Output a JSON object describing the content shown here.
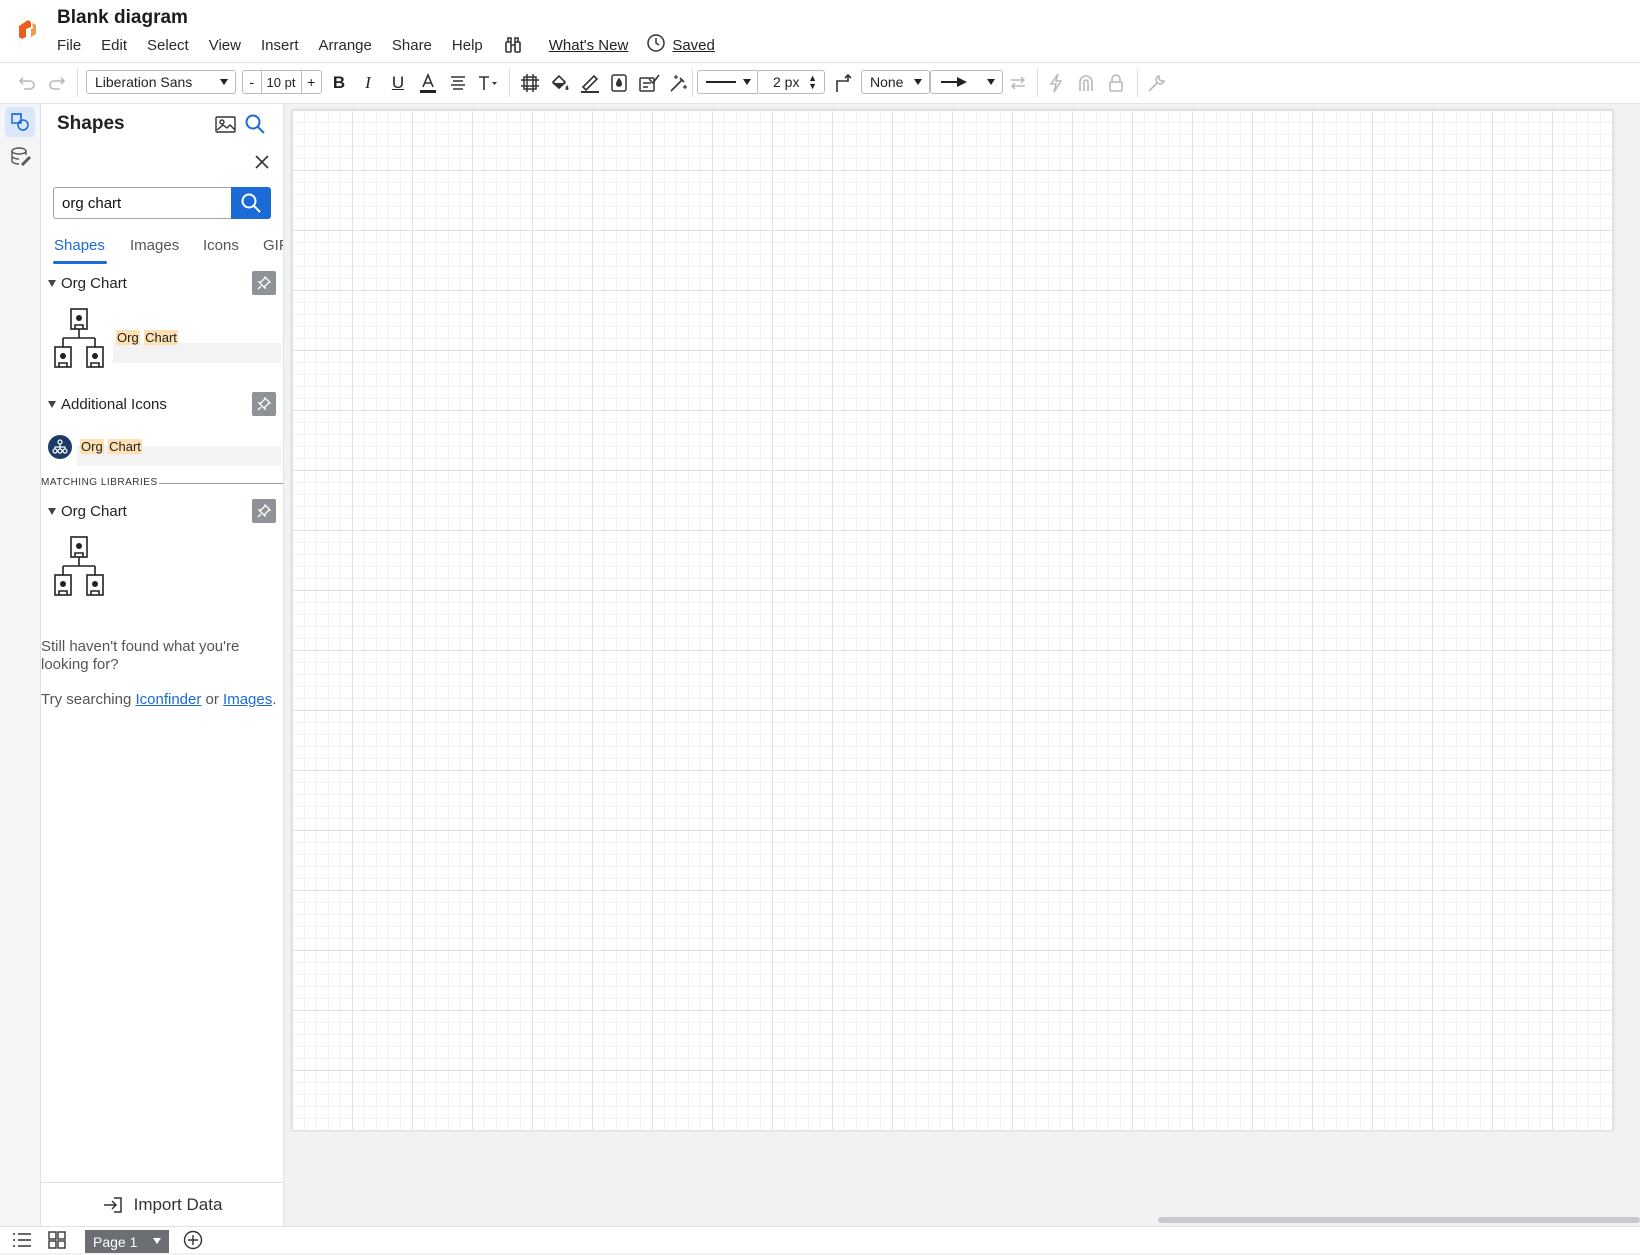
{
  "app": {
    "title": "Blank diagram",
    "menus": [
      "File",
      "Edit",
      "Select",
      "View",
      "Insert",
      "Arrange",
      "Share",
      "Help"
    ],
    "whats_new": "What's New",
    "saved": "Saved",
    "brand_color": "#e8601c"
  },
  "toolbar": {
    "font_family": "Liberation Sans",
    "font_size": "10 pt",
    "decrease": "-",
    "increase": "+",
    "line_width": "2 px",
    "arrow_start": "None"
  },
  "panel": {
    "title": "Shapes",
    "search_value": "org chart",
    "tabs": [
      "Shapes",
      "Images",
      "Icons",
      "GIF"
    ],
    "active_tab": "Shapes",
    "sections": [
      {
        "title": "Org Chart",
        "result": {
          "prefix": "Org",
          "term": "Chart"
        }
      },
      {
        "title": "Additional Icons",
        "result": {
          "prefix": "Org",
          "term": "Chart"
        }
      }
    ],
    "matching_libraries_label": "MATCHING LIBRARIES",
    "library": {
      "title": "Org Chart"
    },
    "hint_line1": "Still haven't found what you're looking for?",
    "hint_try": "Try searching",
    "hint_link1": "Iconfinder",
    "hint_or": "or",
    "hint_link2": "Images",
    "hint_period": ".",
    "import": "Import Data",
    "accent": "#1a6bd6",
    "highlight": "#fde1b4"
  },
  "footer": {
    "page_tab": "Page 1"
  }
}
